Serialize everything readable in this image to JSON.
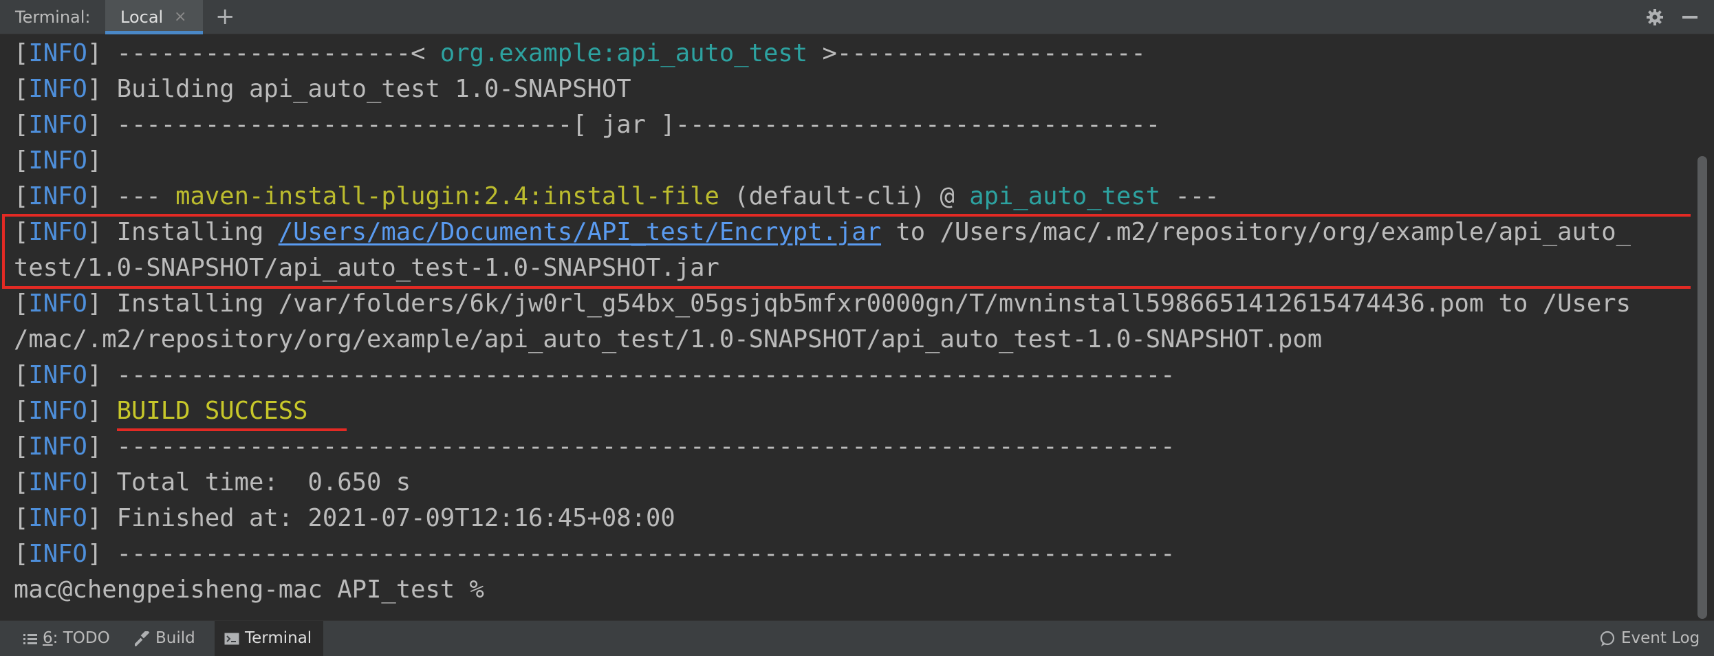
{
  "tabbar": {
    "title": "Terminal:",
    "tabs": [
      {
        "label": "Local",
        "close": "×",
        "active": true
      }
    ],
    "add_tab": "+"
  },
  "terminal": {
    "line1": {
      "prefix": "[",
      "tag": "INFO",
      "close": "]",
      "text1": " --------------------< ",
      "artifact": "org.example:api_auto_test",
      "text2": " >---------------------"
    },
    "line2": {
      "prefix": "[",
      "tag": "INFO",
      "close": "]",
      "text": " Building api_auto_test 1.0-SNAPSHOT"
    },
    "line3": {
      "prefix": "[",
      "tag": "INFO",
      "close": "]",
      "text": " -------------------------------[ jar ]---------------------------------"
    },
    "line4": {
      "prefix": "[",
      "tag": "INFO",
      "close": "]"
    },
    "line5": {
      "prefix": "[",
      "tag": "INFO",
      "close": "]",
      "text1": " --- ",
      "plugin": "maven-install-plugin:2.4:install-file",
      "text2": " (default-cli) @ ",
      "project": "api_auto_test",
      "text3": " ---"
    },
    "line6": {
      "prefix": "[",
      "tag": "INFO",
      "close": "]",
      "text1": " Installing ",
      "path": "/Users/mac/Documents/API_test/Encrypt.jar",
      "text2": " to /Users/mac/.m2/repository/org/example/api_auto_"
    },
    "line7": {
      "text": "test/1.0-SNAPSHOT/api_auto_test-1.0-SNAPSHOT.jar"
    },
    "line8": {
      "prefix": "[",
      "tag": "INFO",
      "close": "]",
      "text": " Installing /var/folders/6k/jw0rl_g54bx_05gsjqb5mfxr0000gn/T/mvninstall5986651412615474436.pom to /Users"
    },
    "line9": {
      "text": "/mac/.m2/repository/org/example/api_auto_test/1.0-SNAPSHOT/api_auto_test-1.0-SNAPSHOT.pom"
    },
    "line10": {
      "prefix": "[",
      "tag": "INFO",
      "close": "]",
      "text": " ------------------------------------------------------------------------"
    },
    "line11": {
      "prefix": "[",
      "tag": "INFO",
      "close": "]",
      "text": " ",
      "status": "BUILD SUCCESS"
    },
    "line12": {
      "prefix": "[",
      "tag": "INFO",
      "close": "]",
      "text": " ------------------------------------------------------------------------"
    },
    "line13": {
      "prefix": "[",
      "tag": "INFO",
      "close": "]",
      "text": " Total time:  0.650 s"
    },
    "line14": {
      "prefix": "[",
      "tag": "INFO",
      "close": "]",
      "text": " Finished at: 2021-07-09T12:16:45+08:00"
    },
    "line15": {
      "prefix": "[",
      "tag": "INFO",
      "close": "]",
      "text": " ------------------------------------------------------------------------"
    },
    "prompt": "mac@chengpeisheng-mac API_test % "
  },
  "bottombar": {
    "todo": {
      "num": "6",
      "label": ": TODO"
    },
    "build": "Build",
    "terminal": "Terminal",
    "event_log": "Event Log"
  },
  "icons": [
    "gear-icon",
    "minimize-icon",
    "list-icon",
    "hammer-icon",
    "terminal-icon",
    "speech-bubble-icon"
  ],
  "colors": {
    "background": "#2b2b2b",
    "info_tag": "#4e8fdb",
    "artifact": "#2da2a0",
    "plugin": "#bcbc2e",
    "link": "#5a9bf0",
    "annotation": "#e32a24"
  }
}
